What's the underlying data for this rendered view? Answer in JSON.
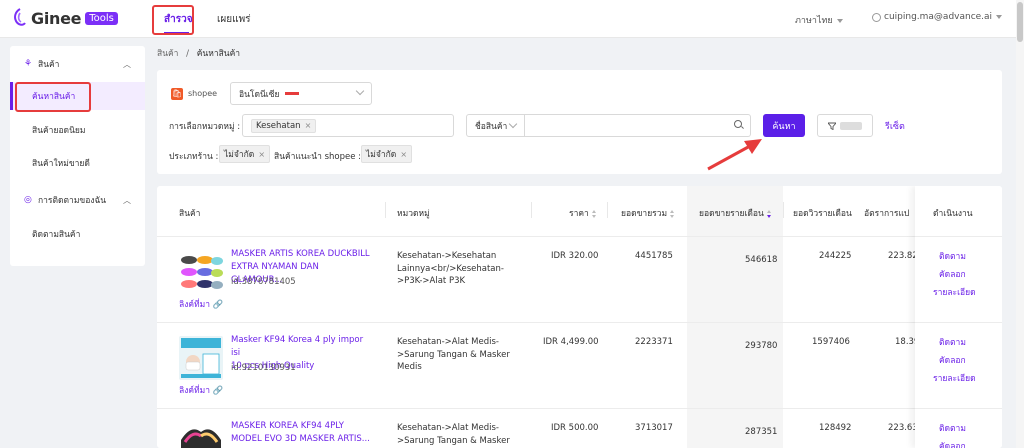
{
  "topbar": {
    "logo_text": "Ginee",
    "logo_badge": "Tools",
    "tabs": [
      {
        "label": "สำรวจ"
      },
      {
        "label": "เผยแพร่"
      }
    ],
    "language": "ภาษาไทย",
    "user_email": "cuiping.ma@advance.ai"
  },
  "sidebar": {
    "groups": [
      {
        "label": "สินค้า",
        "items": [
          {
            "label": "ค้นหาสินค้า"
          },
          {
            "label": "สินค้ายอดนิยม"
          },
          {
            "label": "สินค้าใหม่ขายดี"
          }
        ]
      },
      {
        "label": "การติดตามของฉัน",
        "items": [
          {
            "label": "ติดตามสินค้า"
          }
        ]
      }
    ]
  },
  "breadcrumb": {
    "parent": "สินค้า",
    "separator": "/",
    "current": "ค้นหาสินค้า"
  },
  "filters": {
    "platform": "shopee",
    "country": "อินโดนีเซีย",
    "category_label": "การเลือกหมวดหมู่ :",
    "category_tag": "Kesehatan",
    "search_field": "ชื่อสินค้า",
    "search_value": "",
    "search_button": "ค้นหา",
    "reset": "รีเซ็ต",
    "shop_type_label": "ประเภทร้าน :",
    "shop_type_tag": "ไม่จำกัด",
    "recommended_label": "สินค้าแนะนำ shopee :",
    "recommended_tag": "ไม่จำกัด"
  },
  "table": {
    "headers": [
      "สินค้า",
      "หมวดหมู่",
      "ราคา",
      "ยอดขายรวม",
      "ยอดขายรายเดือน",
      "ยอดวิวรายเดือน",
      "อัตราการแป",
      "ดำเนินงาน"
    ],
    "source_link": "ลิงค์ที่มา",
    "actions": [
      "ติดตาม",
      "คัดลอก",
      "รายละเอียด"
    ],
    "rows": [
      {
        "name_1": "MASKER ARTIS KOREA DUCKBILL",
        "name_2": "EXTRA NYAMAN DAN GLAMOUR...",
        "id": "id:3876781405",
        "cat_1": "Kesehatan->Kesehatan",
        "cat_2": "Lainnya<br/>Kesehatan-",
        "cat_3": ">P3K->Alat P3K",
        "cat_4": "",
        "price": "IDR 320.00",
        "total_sales": "4451785",
        "monthly_sales": "546618",
        "monthly_views": "244225",
        "conversion": "223.82"
      },
      {
        "name_1": "Masker KF94 Korea 4 ply impor isi",
        "name_2": "10 pcs High Quality",
        "id": "id:9210130931",
        "cat_1": "Kesehatan->Alat Medis-",
        "cat_2": ">Sarung Tangan & Masker",
        "cat_3": "Medis",
        "cat_4": "",
        "price": "IDR 4,499.00",
        "total_sales": "2223371",
        "monthly_sales": "293780",
        "monthly_views": "1597406",
        "conversion": "18.39"
      },
      {
        "name_1": "MASKER KOREA KF94 4PLY",
        "name_2": "MODEL EVO 3D MASKER ARTIS...",
        "id": "",
        "cat_1": "Kesehatan->Alat Medis-",
        "cat_2": ">Sarung Tangan & Masker",
        "cat_3": "",
        "cat_4": "",
        "price": "IDR 500.00",
        "total_sales": "3713017",
        "monthly_sales": "287351",
        "monthly_views": "128492",
        "conversion": "223.63"
      }
    ]
  },
  "colors": {
    "accent": "#6a1fe8",
    "button": "#5b1fe8",
    "annotation": "#e63c3c",
    "shopee": "#f05a28"
  }
}
